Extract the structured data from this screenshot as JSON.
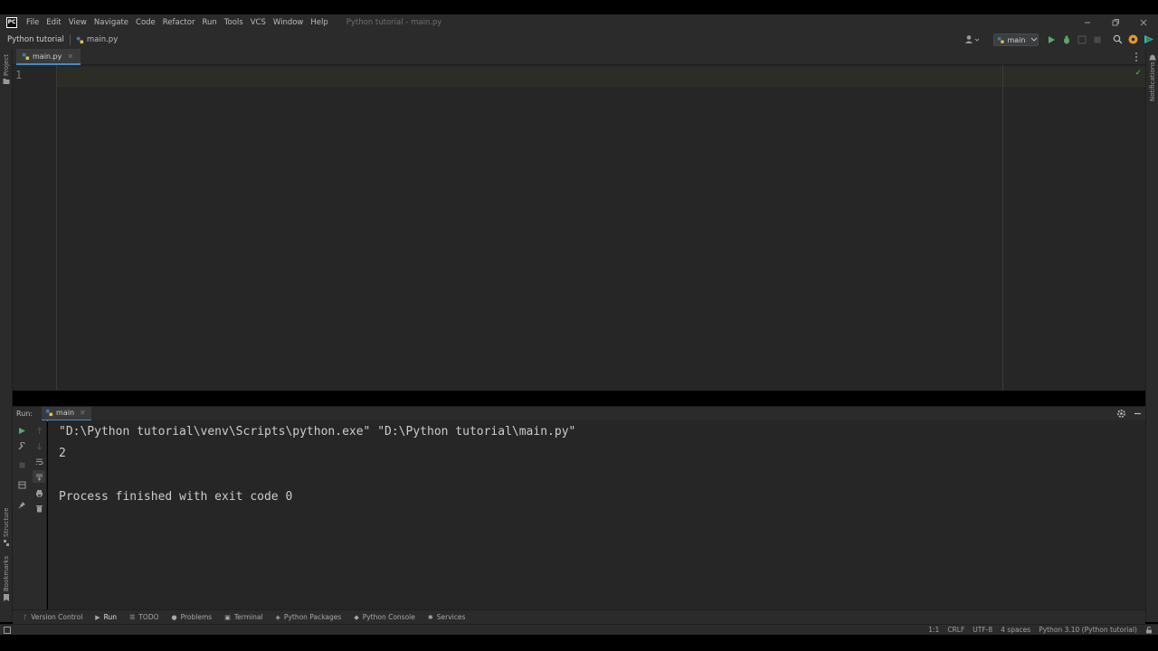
{
  "menu": {
    "logo": "PC",
    "items": [
      "File",
      "Edit",
      "View",
      "Navigate",
      "Code",
      "Refactor",
      "Run",
      "Tools",
      "VCS",
      "Window",
      "Help"
    ],
    "window_title": "Python tutorial - main.py"
  },
  "navbar": {
    "project": "Python tutorial",
    "file": "main.py",
    "run_config": "main"
  },
  "editor": {
    "tab": "main.py",
    "line_numbers": [
      "1"
    ]
  },
  "left_strip": {
    "top_label": "Project",
    "structure": "Structure",
    "bookmarks": "Bookmarks"
  },
  "right_strip": {
    "label": "Notifications"
  },
  "run": {
    "label": "Run:",
    "tab": "main",
    "console": [
      "\"D:\\Python tutorial\\venv\\Scripts\\python.exe\" \"D:\\Python tutorial\\main.py\"",
      "2",
      "",
      "Process finished with exit code 0"
    ]
  },
  "bottom_tabs": [
    "Version Control",
    "Run",
    "TODO",
    "Problems",
    "Terminal",
    "Python Packages",
    "Python Console",
    "Services"
  ],
  "status": {
    "position": "1:1",
    "line_sep": "CRLF",
    "encoding": "UTF-8",
    "indent": "4 spaces",
    "interpreter": "Python 3.10 (Python tutorial)"
  },
  "colors": {
    "accent": "#4a88c7",
    "run_green": "#59a869",
    "background": "#262626"
  }
}
